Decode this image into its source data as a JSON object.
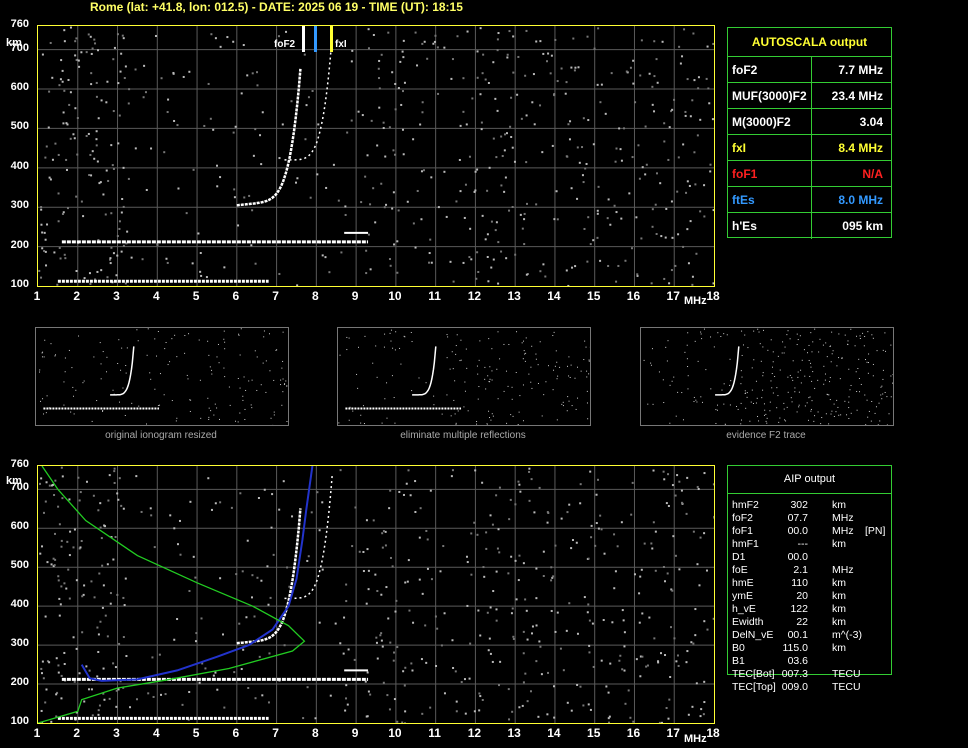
{
  "header": "Rome (lat: +41.8, lon: 012.5) - DATE: 2025 06 19 - TIME (UT): 18:15",
  "axes": {
    "y_ticks": [
      "760",
      "700",
      "600",
      "500",
      "400",
      "300",
      "200",
      "100"
    ],
    "y_unit": "km",
    "x_ticks": [
      "1",
      "2",
      "3",
      "4",
      "5",
      "6",
      "7",
      "8",
      "9",
      "10",
      "11",
      "12",
      "13",
      "14",
      "15",
      "16",
      "17",
      "18"
    ],
    "x_unit": "MHz"
  },
  "markers": {
    "foF2": "foF2",
    "ftEs": "fEs",
    "fxI": "fxI"
  },
  "autoscala": {
    "title": "AUTOSCALA output",
    "rows": [
      {
        "label": "foF2",
        "value": "7.7 MHz",
        "color": "#ffffff"
      },
      {
        "label": "MUF(3000)F2",
        "value": "23.4 MHz",
        "color": "#ffffff"
      },
      {
        "label": "M(3000)F2",
        "value": "3.04",
        "color": "#ffffff"
      },
      {
        "label": "fxI",
        "value": "8.4 MHz",
        "color": "#ffff33"
      },
      {
        "label": "foF1",
        "value": "N/A",
        "color": "#ff2020"
      },
      {
        "label": "ftEs",
        "value": "8.0 MHz",
        "color": "#3399ff"
      },
      {
        "label": "h'Es",
        "value": "095     km",
        "color": "#ffffff"
      }
    ]
  },
  "thumbnails": [
    {
      "caption": "original ionogram resized"
    },
    {
      "caption": "eliminate multiple reflections"
    },
    {
      "caption": "evidence F2 trace"
    }
  ],
  "aip": {
    "title": "AIP output",
    "rows": [
      [
        "hmF2",
        "302",
        "km",
        ""
      ],
      [
        "foF2",
        "07.7",
        "MHz",
        ""
      ],
      [
        "foF1",
        "00.0",
        "MHz",
        "[PN]"
      ],
      [
        "hmF1",
        "---",
        "km",
        ""
      ],
      [
        "D1",
        "00.0",
        "",
        ""
      ],
      [
        "foE",
        "2.1",
        "MHz",
        ""
      ],
      [
        "hmE",
        "110",
        "km",
        ""
      ],
      [
        "ymE",
        "20",
        "km",
        ""
      ],
      [
        "h_vE",
        "122",
        "km",
        ""
      ],
      [
        "Ewidth",
        "22",
        "km",
        ""
      ],
      [
        "DelN_vE",
        "00.1",
        "m^(-3)",
        ""
      ],
      [
        "B0",
        "115.0",
        "km",
        ""
      ],
      [
        "B1",
        "03.6",
        "",
        ""
      ],
      [
        "TEC[Bot]",
        "007.3",
        "TECU",
        ""
      ],
      [
        "TEC[Top]",
        "009.0",
        "TECU",
        ""
      ]
    ]
  },
  "colors": {
    "frame": "#ffff33",
    "grid": "#5a5a5a",
    "table": "#33cc33",
    "profile": "#22cc22",
    "model": "#2233cc"
  }
}
